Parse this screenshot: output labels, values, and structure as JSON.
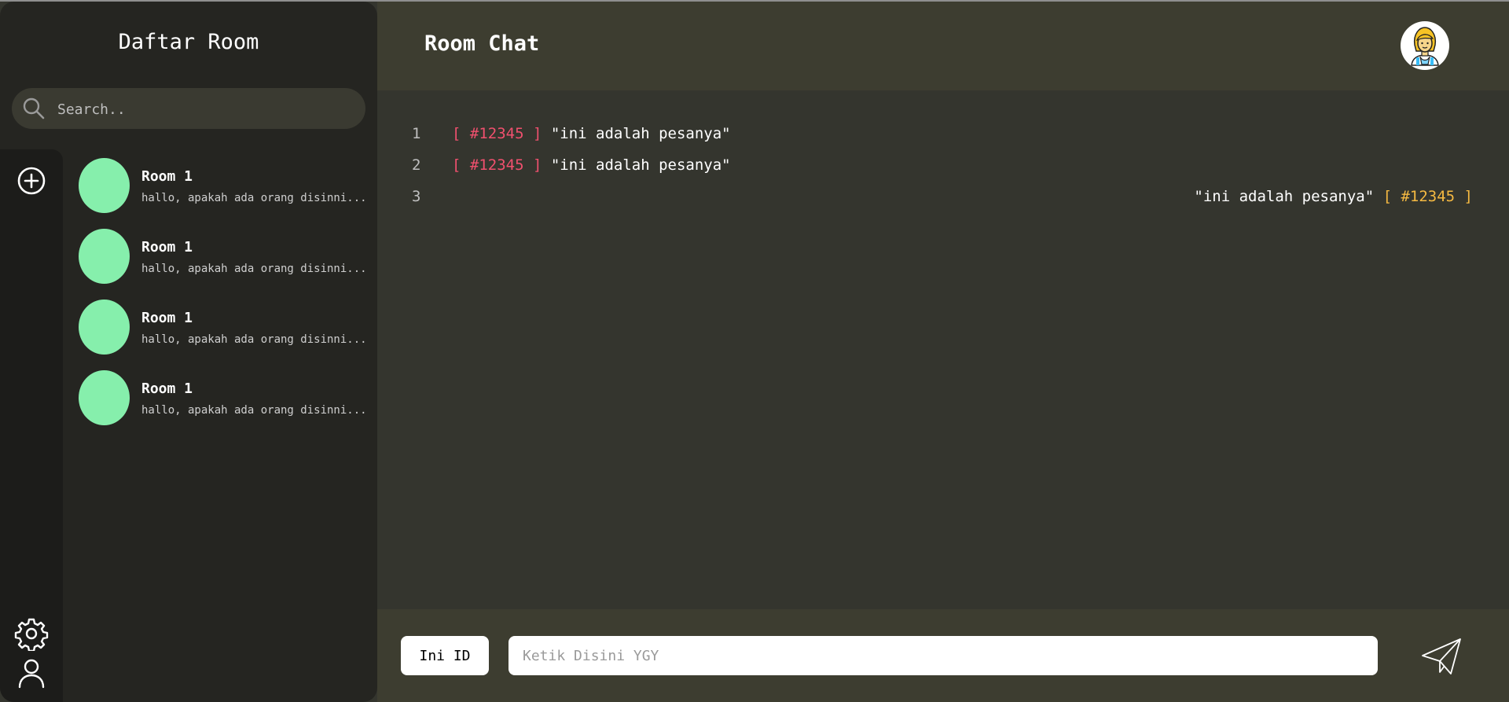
{
  "sidebar": {
    "title": "Daftar Room",
    "search": {
      "placeholder": "Search..",
      "icon": "search-icon"
    },
    "rail": {
      "icons": [
        "plus-circle-icon",
        "gear-icon",
        "user-icon"
      ]
    },
    "rooms": [
      {
        "name": "Room 1",
        "preview": "hallo, apakah ada orang disinni...",
        "avatar_color": "#86efac"
      },
      {
        "name": "Room 1",
        "preview": "hallo, apakah ada orang disinni...",
        "avatar_color": "#86efac"
      },
      {
        "name": "Room 1",
        "preview": "hallo, apakah ada orang disinni...",
        "avatar_color": "#86efac"
      },
      {
        "name": "Room 1",
        "preview": "hallo, apakah ada orang disinni...",
        "avatar_color": "#86efac"
      }
    ]
  },
  "header": {
    "title": "Room Chat",
    "profile_icon": "user-avatar-icon"
  },
  "messages": [
    {
      "num": "1",
      "sender": "[ #12345 ]",
      "text": "\"ini adalah pesanya\"",
      "side": "left"
    },
    {
      "num": "2",
      "sender": "[ #12345 ]",
      "text": "\"ini adalah pesanya\"",
      "side": "left"
    },
    {
      "num": "3",
      "sender": "[ #12345 ]",
      "text": "\"ini adalah pesanya\"",
      "side": "right"
    }
  ],
  "footer": {
    "id_button": "Ini ID",
    "input_placeholder": "Ketik Disini YGY",
    "send_icon": "send-icon"
  },
  "colors": {
    "incoming_tag": "#f0506e",
    "outgoing_tag": "#f5b942",
    "avatar": "#86efac",
    "header_bg": "#3d3d30",
    "sidebar_bg": "#252521"
  }
}
